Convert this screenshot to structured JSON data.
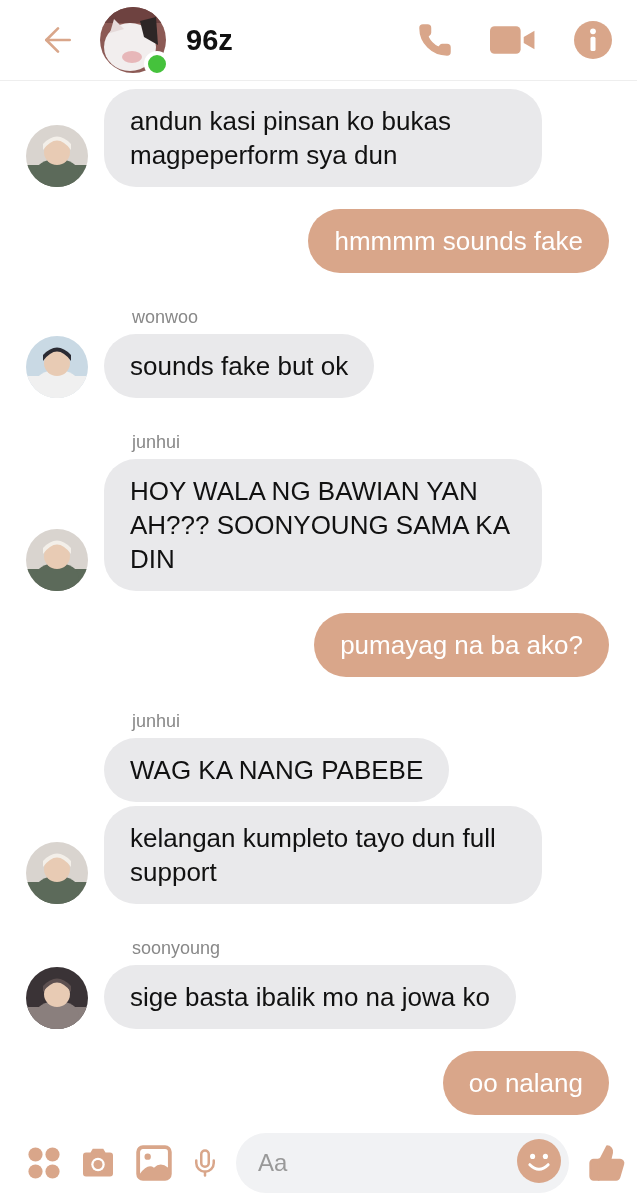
{
  "header": {
    "title": "96z",
    "online": true
  },
  "messages": [
    {
      "kind": "incoming",
      "bubbles": [
        "andun kasi pinsan ko bukas magpeperform sya dun"
      ]
    },
    {
      "kind": "outgoing",
      "bubbles": [
        "hmmmm sounds fake"
      ]
    },
    {
      "kind": "incoming",
      "sender": "wonwoo",
      "bubbles": [
        "sounds fake but ok"
      ]
    },
    {
      "kind": "incoming",
      "sender": "junhui",
      "bubbles": [
        "HOY WALA NG BAWIAN YAN AH??? SOONYOUNG SAMA KA DIN"
      ]
    },
    {
      "kind": "outgoing",
      "bubbles": [
        "pumayag na ba ako?"
      ]
    },
    {
      "kind": "incoming",
      "sender": "junhui",
      "bubbles": [
        "WAG KA NANG PABEBE",
        "kelangan kumpleto tayo dun full support"
      ]
    },
    {
      "kind": "incoming",
      "sender": "soonyoung",
      "bubbles": [
        "sige basta ibalik mo na jowa ko"
      ]
    },
    {
      "kind": "outgoing",
      "bubbles": [
        "oo nalang"
      ]
    }
  ],
  "composer": {
    "placeholder": "Aa"
  }
}
